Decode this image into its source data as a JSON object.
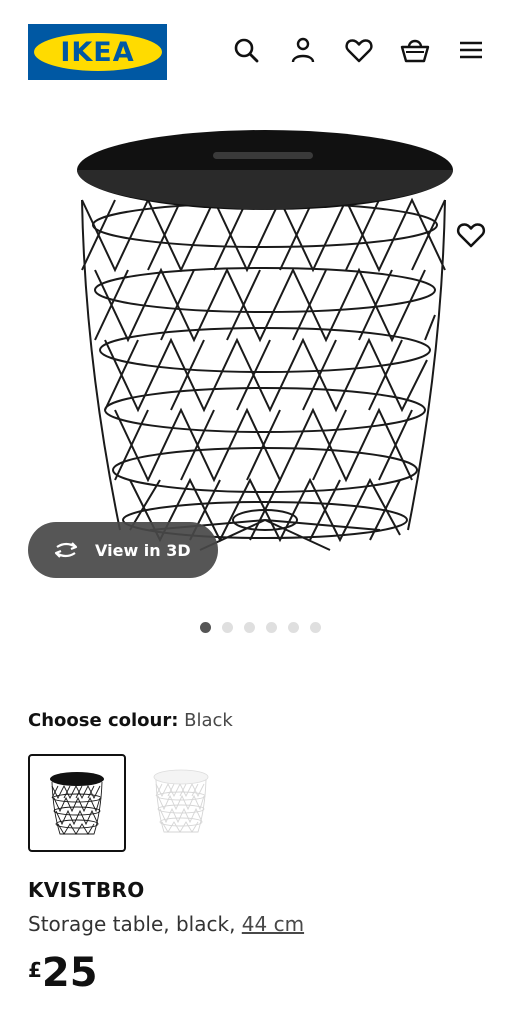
{
  "header": {
    "logo_text": "IKEA",
    "brand_colors": {
      "blue": "#0058a3",
      "yellow": "#ffdb00"
    },
    "icons": [
      "search-icon",
      "account-icon",
      "wishlist-heart-icon",
      "shopping-bag-icon",
      "menu-icon"
    ]
  },
  "gallery": {
    "view_3d_label": "View in 3D",
    "slide_count": 6,
    "active_slide": 1
  },
  "colour": {
    "label": "Choose colour:",
    "selected": "Black",
    "options": [
      "Black",
      "White"
    ]
  },
  "product": {
    "name": "KVISTBRO",
    "description": "Storage table, black,",
    "size": "44 cm",
    "price_currency": "£",
    "price_value": "25"
  }
}
